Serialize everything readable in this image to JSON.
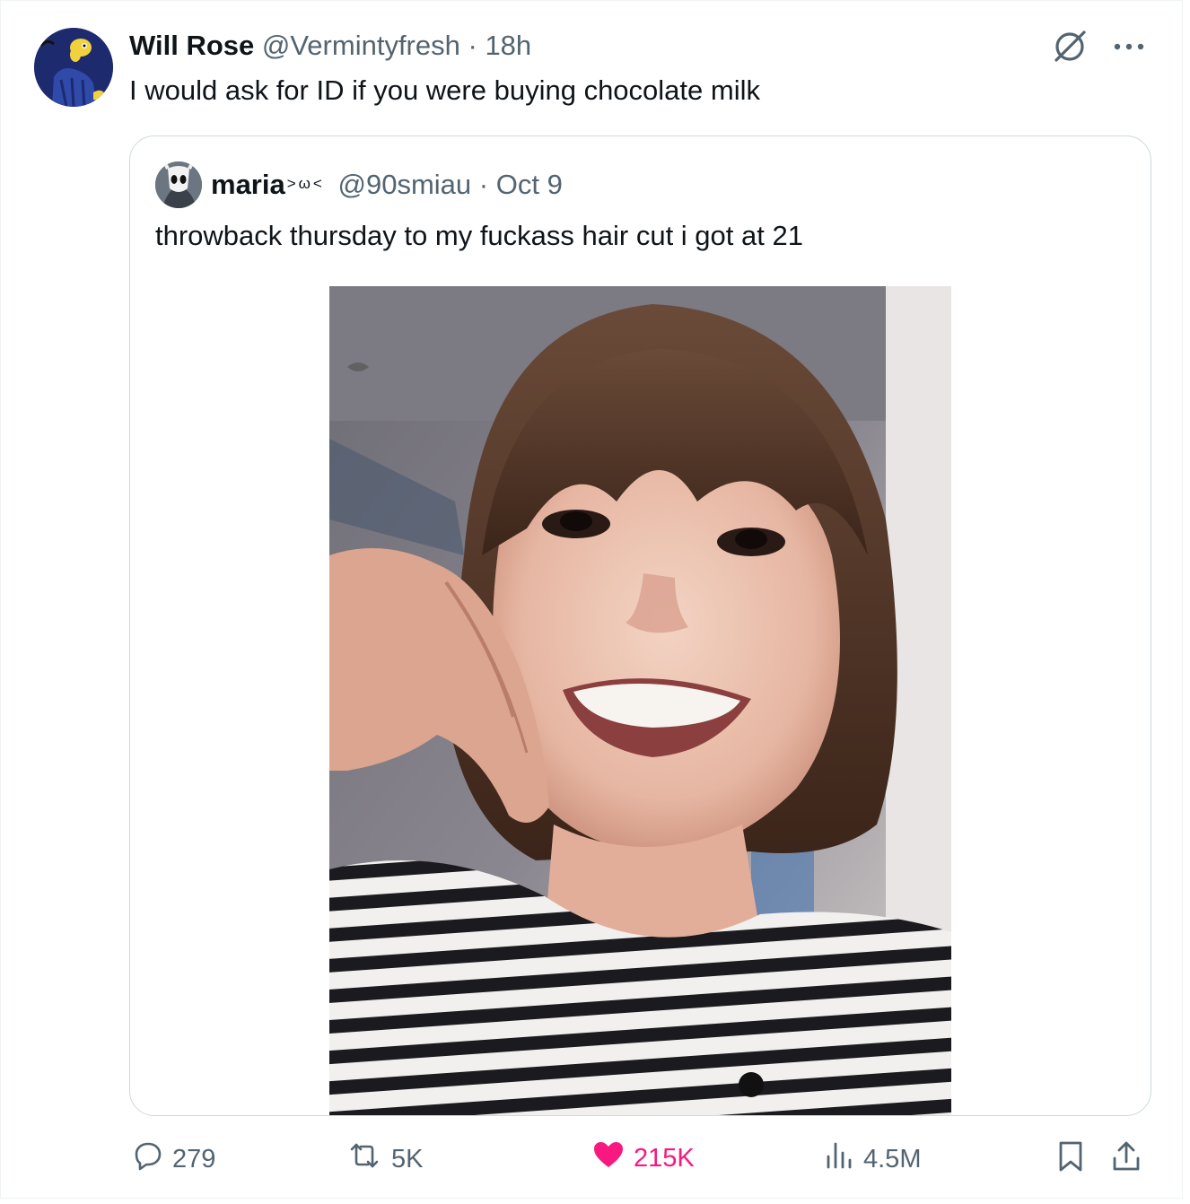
{
  "tweet": {
    "author_name": "Will Rose",
    "author_handle": "@Vermintyfresh",
    "separator": "·",
    "time": "18h",
    "text": "I would ask for ID if you were buying chocolate milk"
  },
  "quote": {
    "author_name": "maria",
    "author_emote": ">ω<",
    "author_handle": "@90smiau",
    "separator": "·",
    "date": "Oct 9",
    "text": "throwback thursday to my fuckass hair cut i got at 21"
  },
  "actions": {
    "replies": "279",
    "reposts": "5K",
    "likes": "215K",
    "views": "4.5M"
  },
  "icons": [
    "grok-icon",
    "more-icon",
    "reply-icon",
    "repost-icon",
    "heart-icon",
    "views-icon",
    "bookmark-icon",
    "share-icon"
  ],
  "colors": {
    "like": "#f91880",
    "muted": "#536471",
    "text": "#0f1419",
    "border": "#cfd9de"
  }
}
